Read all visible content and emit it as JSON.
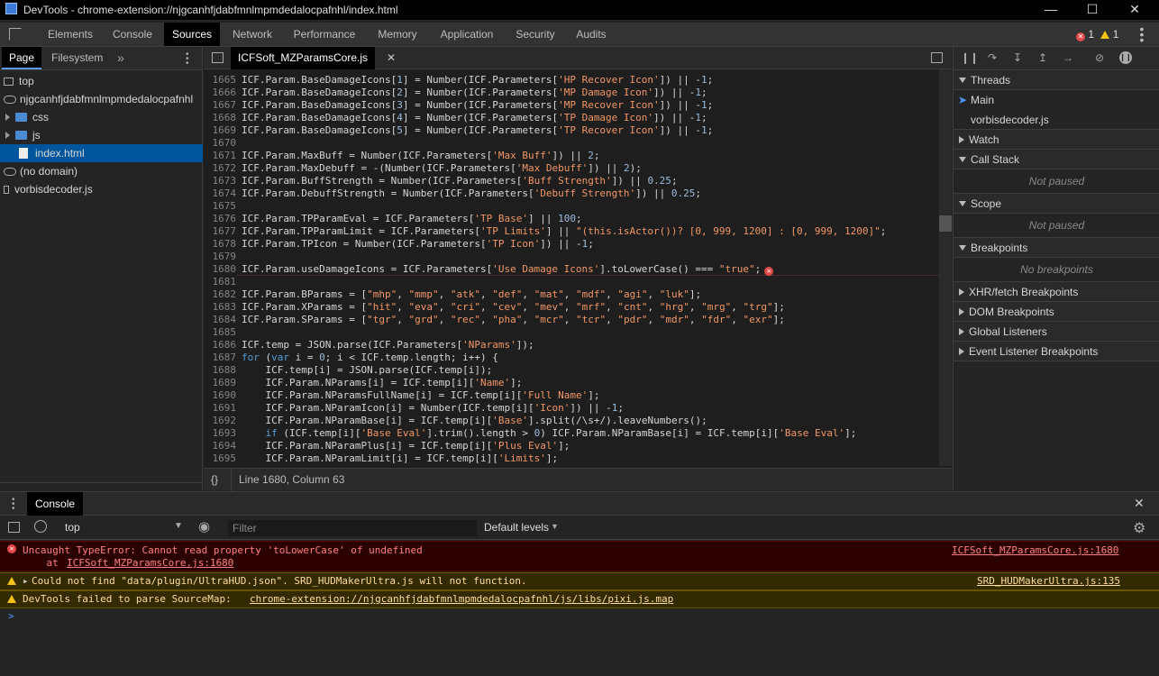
{
  "window": {
    "title": "DevTools - chrome-extension://njgcanhfjdabfmnlmpmdedalocpafnhl/index.html"
  },
  "main_tabs": [
    "Elements",
    "Console",
    "Sources",
    "Network",
    "Performance",
    "Memory",
    "Application",
    "Security",
    "Audits"
  ],
  "active_main_tab": "Sources",
  "counts": {
    "errors": "1",
    "warnings": "1"
  },
  "navigator": {
    "tabs": [
      "Page",
      "Filesystem"
    ],
    "tree": [
      {
        "label": "top",
        "kind": "frame",
        "indent": 0
      },
      {
        "label": "njgcanhfjdabfmnlmpmdedalocpafnhl",
        "kind": "cloud",
        "indent": 0
      },
      {
        "label": "css",
        "kind": "folder",
        "indent": 1
      },
      {
        "label": "js",
        "kind": "folder",
        "indent": 1
      },
      {
        "label": "index.html",
        "kind": "file",
        "indent": 2,
        "selected": true
      },
      {
        "label": "(no domain)",
        "kind": "cloud",
        "indent": 0
      },
      {
        "label": "vorbisdecoder.js",
        "kind": "file",
        "indent": 0
      }
    ]
  },
  "editor": {
    "tab_label": "ICFSoft_MZParamsCore.js",
    "status": "Line 1680, Column 63",
    "pretty_print": "{}",
    "lines": [
      {
        "n": "1665",
        "t": "ICF.Param.BaseDamageIcons[1] = Number(ICF.Parameters['HP Recover Icon']) || -1;"
      },
      {
        "n": "1666",
        "t": "ICF.Param.BaseDamageIcons[2] = Number(ICF.Parameters['MP Damage Icon']) || -1;"
      },
      {
        "n": "1667",
        "t": "ICF.Param.BaseDamageIcons[3] = Number(ICF.Parameters['MP Recover Icon']) || -1;"
      },
      {
        "n": "1668",
        "t": "ICF.Param.BaseDamageIcons[4] = Number(ICF.Parameters['TP Damage Icon']) || -1;"
      },
      {
        "n": "1669",
        "t": "ICF.Param.BaseDamageIcons[5] = Number(ICF.Parameters['TP Recover Icon']) || -1;"
      },
      {
        "n": "1670",
        "t": ""
      },
      {
        "n": "1671",
        "t": "ICF.Param.MaxBuff = Number(ICF.Parameters['Max Buff']) || 2;"
      },
      {
        "n": "1672",
        "t": "ICF.Param.MaxDebuff = -(Number(ICF.Parameters['Max Debuff']) || 2);"
      },
      {
        "n": "1673",
        "t": "ICF.Param.BuffStrength = Number(ICF.Parameters['Buff Strength']) || 0.25;"
      },
      {
        "n": "1674",
        "t": "ICF.Param.DebuffStrength = Number(ICF.Parameters['Debuff Strength']) || 0.25;"
      },
      {
        "n": "1675",
        "t": ""
      },
      {
        "n": "1676",
        "t": "ICF.Param.TPParamEval = ICF.Parameters['TP Base'] || 100;"
      },
      {
        "n": "1677",
        "t": "ICF.Param.TPParamLimit = ICF.Parameters['TP Limits'] || \"(this.isActor())? [0, 999, 1200] : [0, 999, 1200]\";"
      },
      {
        "n": "1678",
        "t": "ICF.Param.TPIcon = Number(ICF.Parameters['TP Icon']) || -1;"
      },
      {
        "n": "1679",
        "t": ""
      },
      {
        "n": "1680",
        "t": "ICF.Param.useDamageIcons = ICF.Parameters['Use Damage Icons'].toLowerCase() === \"true\";",
        "error": true
      },
      {
        "n": "1681",
        "t": ""
      },
      {
        "n": "1682",
        "t": "ICF.Param.BParams = [\"mhp\", \"mmp\", \"atk\", \"def\", \"mat\", \"mdf\", \"agi\", \"luk\"];"
      },
      {
        "n": "1683",
        "t": "ICF.Param.XParams = [\"hit\", \"eva\", \"cri\", \"cev\", \"mev\", \"mrf\", \"cnt\", \"hrg\", \"mrg\", \"trg\"];"
      },
      {
        "n": "1684",
        "t": "ICF.Param.SParams = [\"tgr\", \"grd\", \"rec\", \"pha\", \"mcr\", \"tcr\", \"pdr\", \"mdr\", \"fdr\", \"exr\"];"
      },
      {
        "n": "1685",
        "t": ""
      },
      {
        "n": "1686",
        "t": "ICF.temp = JSON.parse(ICF.Parameters['NParams']);"
      },
      {
        "n": "1687",
        "t": "for (var i = 0; i < ICF.temp.length; i++) {"
      },
      {
        "n": "1688",
        "t": "    ICF.temp[i] = JSON.parse(ICF.temp[i]);"
      },
      {
        "n": "1689",
        "t": "    ICF.Param.NParams[i] = ICF.temp[i]['Name'];"
      },
      {
        "n": "1690",
        "t": "    ICF.Param.NParamsFullName[i] = ICF.temp[i]['Full Name'];"
      },
      {
        "n": "1691",
        "t": "    ICF.Param.NParamIcon[i] = Number(ICF.temp[i]['Icon']) || -1;"
      },
      {
        "n": "1692",
        "t": "    ICF.Param.NParamBase[i] = ICF.temp[i]['Base'].split(/\\s+/).leaveNumbers();"
      },
      {
        "n": "1693",
        "t": "    if (ICF.temp[i]['Base Eval'].trim().length > 0) ICF.Param.NParamBase[i] = ICF.temp[i]['Base Eval'];"
      },
      {
        "n": "1694",
        "t": "    ICF.Param.NParamPlus[i] = ICF.temp[i]['Plus Eval'];"
      },
      {
        "n": "1695",
        "t": "    ICF.Param.NParamLimit[i] = ICF.temp[i]['Limits'];"
      }
    ]
  },
  "debugger": {
    "sections": [
      {
        "label": "Threads",
        "open": true
      },
      {
        "label": "Watch",
        "open": false
      },
      {
        "label": "Call Stack",
        "open": true,
        "note": "Not paused"
      },
      {
        "label": "Scope",
        "open": true,
        "note": "Not paused"
      },
      {
        "label": "Breakpoints",
        "open": true,
        "note": "No breakpoints"
      },
      {
        "label": "XHR/fetch Breakpoints",
        "open": false
      },
      {
        "label": "DOM Breakpoints",
        "open": false
      },
      {
        "label": "Global Listeners",
        "open": false
      },
      {
        "label": "Event Listener Breakpoints",
        "open": false
      }
    ],
    "threads": [
      "Main",
      "vorbisdecoder.js"
    ]
  },
  "console": {
    "tab_label": "Console",
    "context": "top",
    "filter_placeholder": "Filter",
    "levels": "Default levels",
    "messages": [
      {
        "level": "error",
        "text": "Uncaught TypeError: Cannot read property 'toLowerCase' of undefined",
        "sub_prefix": "    at ",
        "sub_link": "ICFSoft_MZParamsCore.js:1680",
        "source": "ICFSoft_MZParamsCore.js:1680"
      },
      {
        "level": "warning",
        "text": "Could not find \"data/plugin/UltraHUD.json\". SRD_HUDMakerUltra.js will not function.",
        "source": "SRD_HUDMakerUltra.js:135"
      },
      {
        "level": "warning",
        "text": "DevTools failed to parse SourceMap: ",
        "link": "chrome-extension://njgcanhfjdabfmnlmpmdedalocpafnhl/js/libs/pixi.js.map"
      }
    ],
    "prompt": ">"
  },
  "colors": {
    "selection": "#00569c",
    "error": "#ff8080",
    "warning": "#ffdd9e",
    "string": "#f29766",
    "keyword": "#569cd6"
  }
}
